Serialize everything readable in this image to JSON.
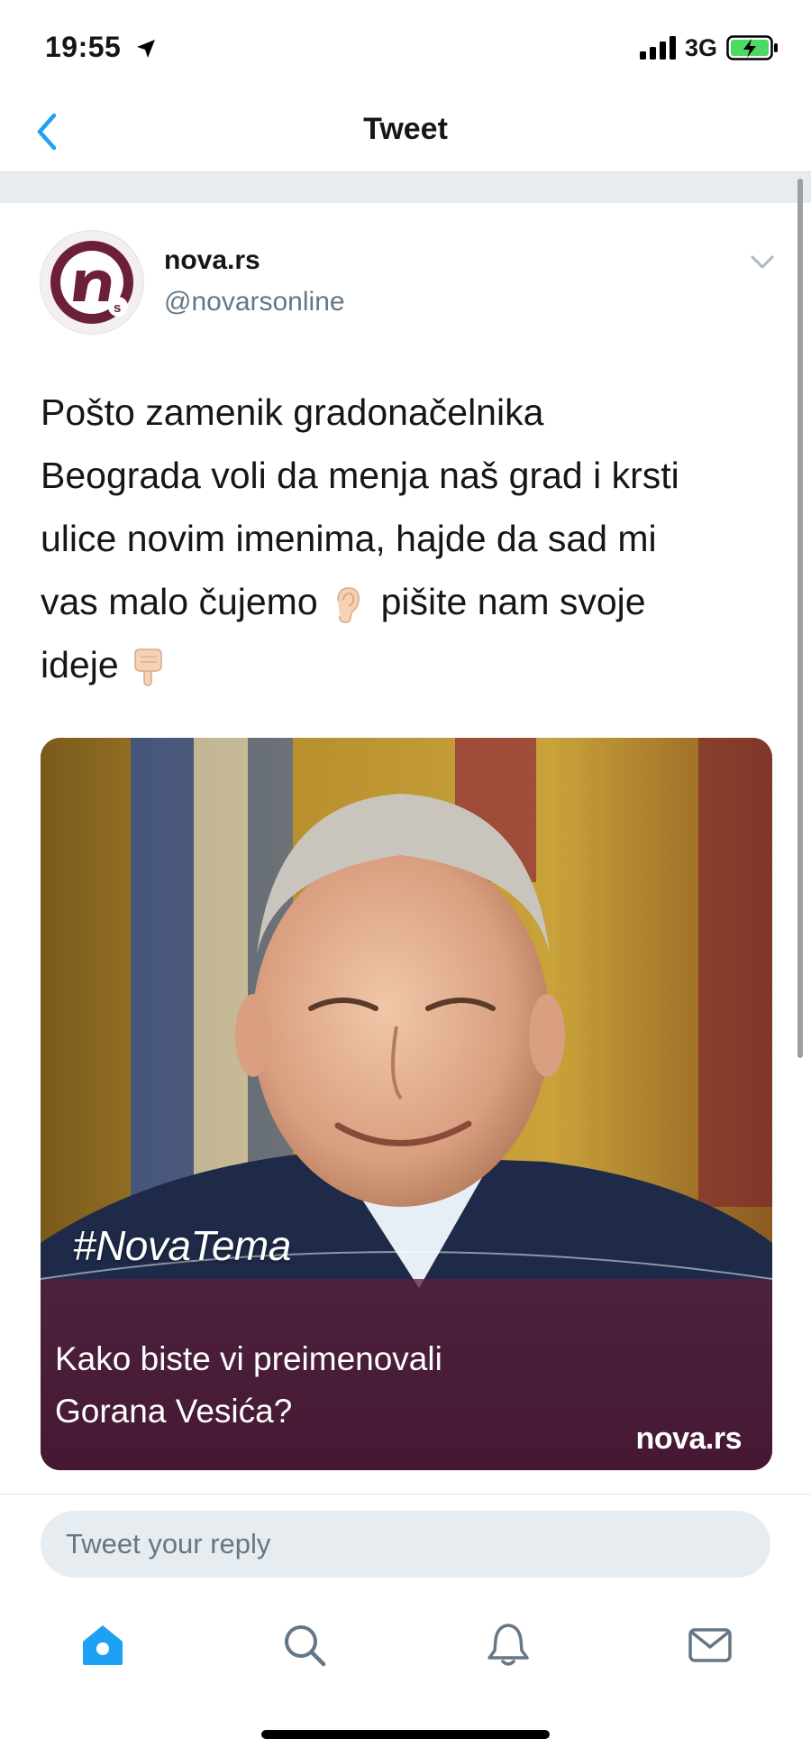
{
  "status_bar": {
    "time": "19:55",
    "network": "3G",
    "icons": [
      "location-arrow-icon",
      "signal-bars-icon",
      "battery-charging-icon"
    ]
  },
  "nav": {
    "title": "Tweet",
    "back_icon": "chevron-left-icon",
    "accent_color": "#1da1f2"
  },
  "tweet": {
    "author_name": "nova.rs",
    "author_handle": "@novarsonline",
    "avatar_icon": "nova-logo",
    "text_lines": [
      "Pošto zamenik gradonačelnika",
      "Beograda voli da menja naš grad i krsti",
      "ulice novim imenima, hajde da sad mi",
      "vas malo čujemo",
      "pišite nam svoje",
      "ideje"
    ],
    "emojis": [
      "ear-emoji",
      "pointing-down-emoji"
    ],
    "media": {
      "hashtag": "#NovaTema",
      "caption_line1": "Kako biste vi preimenovali",
      "caption_line2": "Gorana Vesića?",
      "brand": "nova.rs",
      "brand_color": "#6b1f3a"
    }
  },
  "reply": {
    "placeholder": "Tweet your reply"
  },
  "tab_bar": {
    "items": [
      "home-icon",
      "search-icon",
      "notifications-bell-icon",
      "messages-envelope-icon"
    ],
    "active": "home-icon",
    "active_color": "#1da1f2",
    "inactive_color": "#657786"
  }
}
